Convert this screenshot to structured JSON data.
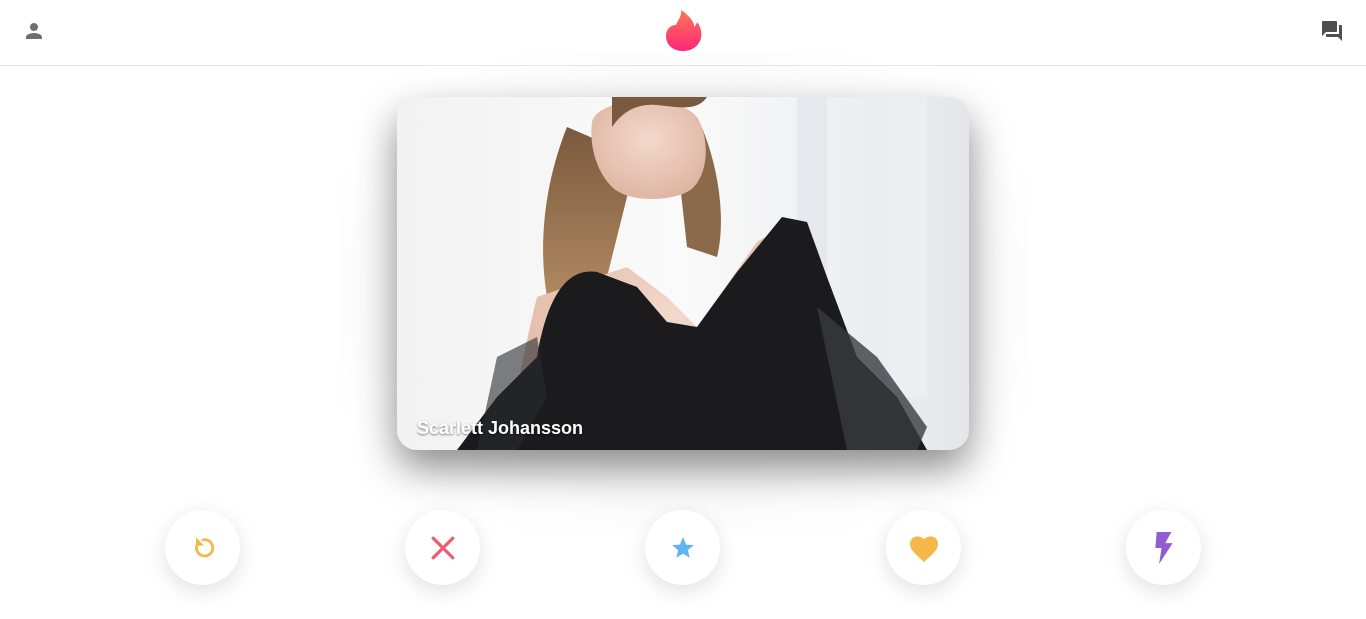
{
  "header": {
    "profile_icon": "person-icon",
    "logo_icon": "flame-logo-icon",
    "messages_icon": "forum-icon"
  },
  "card": {
    "name": "Scarlett Johansson"
  },
  "actions": [
    {
      "name": "rewind",
      "icon": "rewind-icon",
      "color": "#F5B748"
    },
    {
      "name": "nope",
      "icon": "close-icon",
      "color": "#EC5E6F"
    },
    {
      "name": "super-like",
      "icon": "star-icon",
      "color": "#62B4F0"
    },
    {
      "name": "like",
      "icon": "heart-icon",
      "color": "#F5B748"
    },
    {
      "name": "boost",
      "icon": "bolt-icon",
      "color": "#915DD1"
    }
  ],
  "colors": {
    "brand_gradient_start": "#FD267A",
    "brand_gradient_end": "#FF7854"
  }
}
